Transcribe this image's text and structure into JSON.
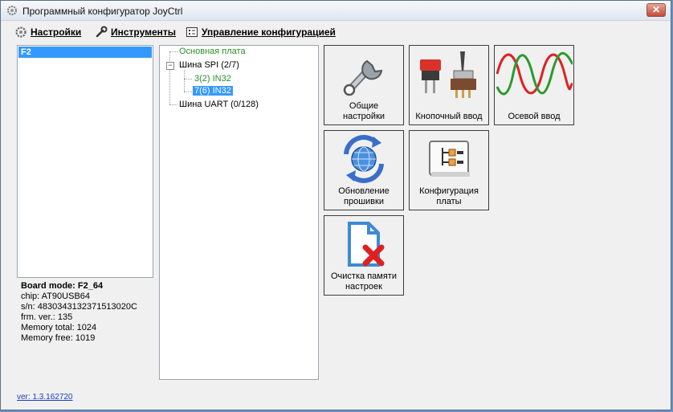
{
  "window": {
    "title": "Программный конфигуратор JoyCtrl",
    "close_symbol": "✕"
  },
  "menu": [
    {
      "label": "Настройки",
      "icon": "gear-icon"
    },
    {
      "label": "Инструменты",
      "icon": "wrench-icon"
    },
    {
      "label": "Управление конфигурацией",
      "icon": "config-icon"
    }
  ],
  "boards_list": {
    "items": [
      "F2"
    ],
    "selected": "F2"
  },
  "board_info": {
    "mode": "Board mode: F2_64",
    "chip": "chip: AT90USB64",
    "serial": "s/n: 4830343132371513020C",
    "firmware": "frm. ver.: 135",
    "memory_total": "Memory total: 1024",
    "memory_free": "Memory free: 1019"
  },
  "tree": {
    "root": "Основная плата",
    "spi_bus": "Шина SPI (2/7)",
    "spi_children": [
      "3(2) IN32",
      "7(6) IN32"
    ],
    "selected": "7(6) IN32",
    "uart_bus": "Шина UART (0/128)",
    "expander_symbol": "−"
  },
  "tiles": {
    "general": "Общие\nнастройки",
    "buttons": "Кнопочный ввод",
    "axis": "Осевой ввод",
    "firmware": "Обновление\nпрошивки",
    "board_config": "Конфигурация\nплаты",
    "clear_memory": "Очистка памяти\nнастроек"
  },
  "version": "ver: 1.3.162720",
  "colors": {
    "selection": "#3399ff",
    "tree_green": "#2b8c2b",
    "link": "#1a3dbf"
  }
}
